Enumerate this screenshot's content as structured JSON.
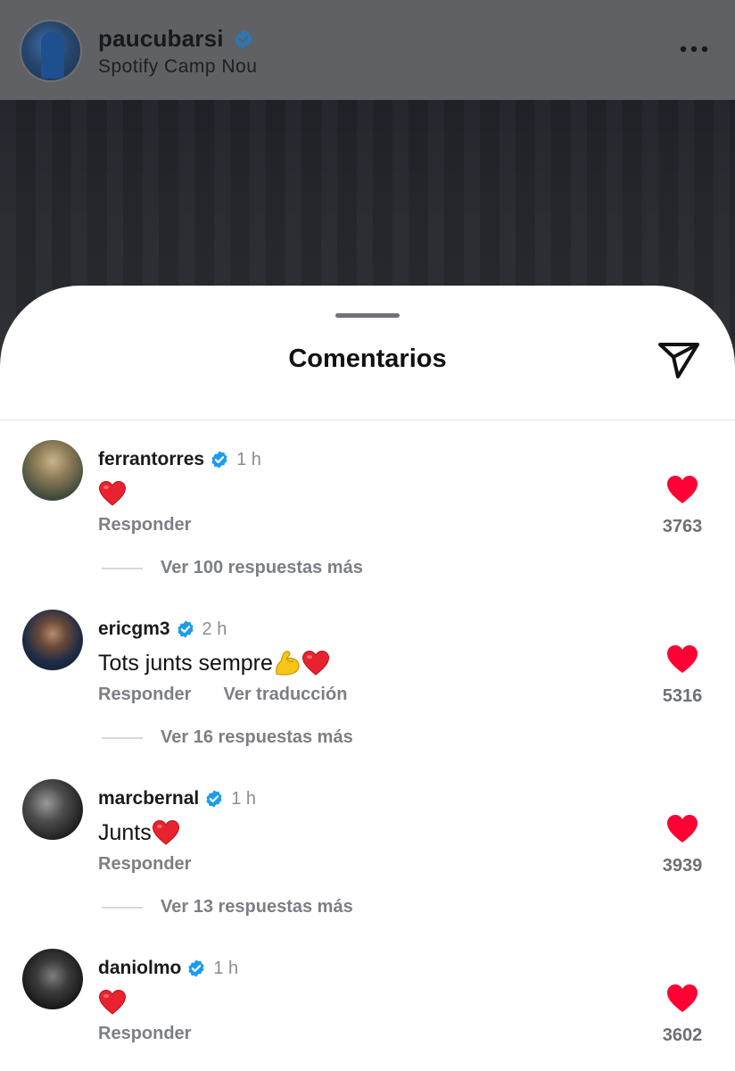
{
  "post": {
    "username": "paucubarsi",
    "location": "Spotify Camp Nou"
  },
  "sheet": {
    "title": "Comentarios"
  },
  "comments": [
    {
      "username": "ferrantorres",
      "time": "1 h",
      "text": "",
      "emoji": [
        "red-heart"
      ],
      "actions": [
        "Responder"
      ],
      "replies_label": "Ver 100 respuestas más",
      "likes": "3763"
    },
    {
      "username": "ericgm3",
      "time": "2 h",
      "text": "Tots junts sempre",
      "emoji": [
        "flexed-biceps",
        "red-heart"
      ],
      "actions": [
        "Responder",
        "Ver traducción"
      ],
      "replies_label": "Ver 16 respuestas más",
      "likes": "5316"
    },
    {
      "username": "marcbernal",
      "time": "1 h",
      "text": "Junts",
      "emoji": [
        "red-heart"
      ],
      "actions": [
        "Responder"
      ],
      "replies_label": "Ver 13 respuestas más",
      "likes": "3939"
    },
    {
      "username": "daniolmo",
      "time": "1 h",
      "text": "",
      "emoji": [
        "red-heart"
      ],
      "actions": [
        "Responder"
      ],
      "replies_label": "",
      "likes": "3602"
    }
  ],
  "colors": {
    "verified": "#1d9bf0",
    "like_heart": "#ff0034",
    "secondary_text": "#7c7f84"
  }
}
